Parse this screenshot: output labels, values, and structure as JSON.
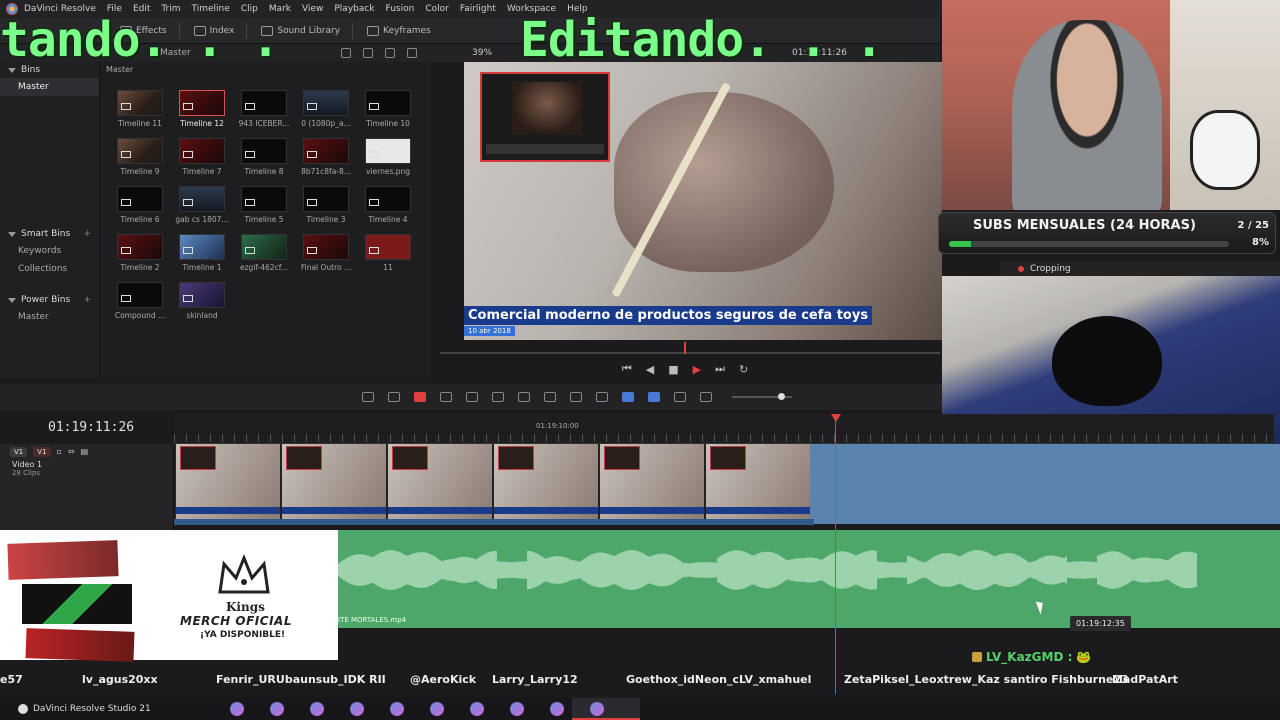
{
  "menu": {
    "app_name": "DaVinci Resolve",
    "items": [
      "File",
      "Edit",
      "Trim",
      "Timeline",
      "Clip",
      "Mark",
      "View",
      "Playback",
      "Fusion",
      "Color",
      "Fairlight",
      "Workspace",
      "Help"
    ]
  },
  "toolbar": {
    "effects": "Effects",
    "index": "Index",
    "sound_library": "Sound Library",
    "keyframes": "Keyframes"
  },
  "media_pool": {
    "header_label": "Master",
    "bins_label": "Bins",
    "master_bin": "Master",
    "smart_bins_label": "Smart Bins",
    "keywords": "Keywords",
    "collections": "Collections",
    "power_bins_label": "Power Bins",
    "power_master": "Master",
    "grid_title": "Master",
    "clips": [
      {
        "name": "Timeline 11",
        "kind": "face"
      },
      {
        "name": "Timeline 12",
        "kind": "red",
        "selected": true
      },
      {
        "name": "943 ICEBER...",
        "kind": "plain"
      },
      {
        "name": "0 (1080p_a...",
        "kind": "screen"
      },
      {
        "name": "Timeline 10",
        "kind": "plain"
      },
      {
        "name": "Timeline 9",
        "kind": "face"
      },
      {
        "name": "Timeline 7",
        "kind": "red"
      },
      {
        "name": "Timeline 8",
        "kind": "plain"
      },
      {
        "name": "8b71c8fa-8...",
        "kind": "red"
      },
      {
        "name": "viernes.png",
        "kind": "doc"
      },
      {
        "name": "Timeline 6",
        "kind": "plain"
      },
      {
        "name": "gab cs 1807...",
        "kind": "screen"
      },
      {
        "name": "Timeline 5",
        "kind": "plain"
      },
      {
        "name": "Timeline 3",
        "kind": "plain"
      },
      {
        "name": "Timeline 4",
        "kind": "plain"
      },
      {
        "name": "Timeline 2",
        "kind": "red"
      },
      {
        "name": "Timeline 1",
        "kind": "blue"
      },
      {
        "name": "ezgif-462cf...",
        "kind": "green"
      },
      {
        "name": "Final Outro ...",
        "kind": "red"
      },
      {
        "name": "11",
        "kind": "red2"
      },
      {
        "name": "Compound ...",
        "kind": "plain"
      },
      {
        "name": "skinland",
        "kind": "purple"
      }
    ]
  },
  "viewer": {
    "zoom": "39%",
    "timecode": "01:19:11:26",
    "caption": "Comercial moderno de productos seguros de cefa toys",
    "caption_date": "10 abr 2018"
  },
  "overlay": {
    "left_text": "tando. . .",
    "center_text": "Editando. . ."
  },
  "stream": {
    "subs_label": "SUBS MENSUALES (24 HORAS)",
    "subs_count": "2 / 25",
    "subs_percent_text": "8%",
    "subs_fraction": 0.08,
    "crop_label": "Cropping"
  },
  "timeline": {
    "timecode": "01:19:11:26",
    "ruler_label": "01:19:10:00",
    "track_v1": "V1",
    "track_v1b": "V1",
    "track_name": "Video 1",
    "track_clips": "28 Clips",
    "audio_clip_name": "ITE MORTALES.mp4",
    "hover_tc": "01:19:12:35"
  },
  "merch": {
    "brand": "Kings",
    "line1": "MERCH OFICIAL",
    "line2": "¡YA DISPONIBLE!"
  },
  "chat": {
    "highlight_user": "LV_KazGMD :",
    "ticker": [
      "e57",
      "lv_agus20xx",
      "Fenrir_URUbaunsub_IDK RII",
      "@AeroKick",
      "Larry_Larry12",
      "Goethox_idNeon_cLV_xmahuel",
      "ZetaPiksel_Leoxtrew_Kaz santiro Fishburne23",
      "MadPatArt"
    ]
  },
  "taskbar": {
    "app_label": "DaVinci Resolve Studio 21"
  },
  "colors": {
    "accent_red": "#e04040",
    "video_track": "#5a84ad",
    "audio_track": "#4ea76a",
    "overlay_green": "#7cff8a"
  }
}
